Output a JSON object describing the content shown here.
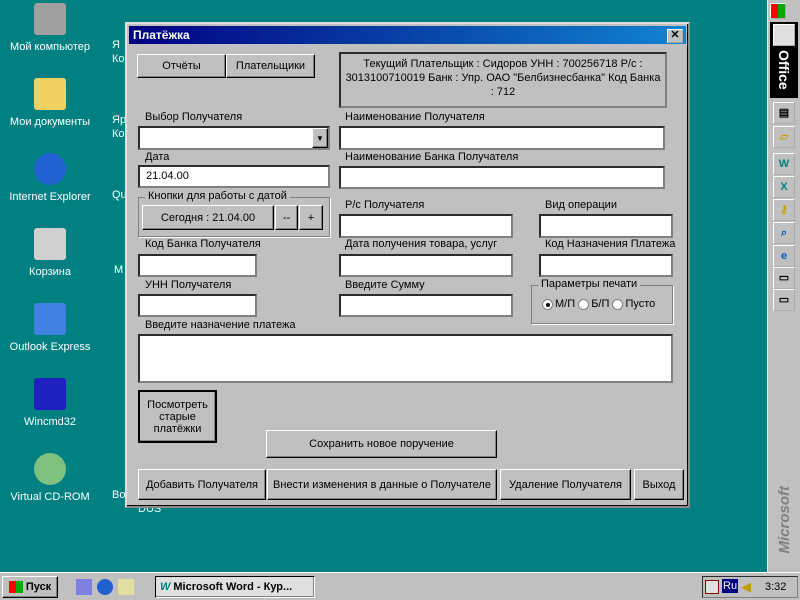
{
  "desktop": {
    "icons": [
      {
        "label": "Мой компьютер",
        "color": "#a0a0a0"
      },
      {
        "label": "Мои документы",
        "color": "#f0d060"
      },
      {
        "label": "Internet Explorer",
        "color": "#2060d0"
      },
      {
        "label": "Корзина",
        "color": "#d0d0d0"
      },
      {
        "label": "Outlook Express",
        "color": "#4080e0"
      },
      {
        "label": "Wincmd32",
        "color": "#2020c0"
      },
      {
        "label": "Virtual CD-ROM",
        "color": "#80c080"
      }
    ],
    "partial_labels": [
      "Я\nКо",
      "Яр\nКо",
      "Qu",
      "М",
      "Во",
      "DUS"
    ]
  },
  "window": {
    "title": "Платёжка",
    "close": "✕",
    "buttons": {
      "reports": "Отчёты",
      "payers": "Плательщики",
      "view_old": "Посмотреть старые платёжки",
      "save_new": "Сохранить новое поручение",
      "add_recipient": "Добавить Получателя",
      "edit_recipient": "Внести изменения в данные о Получателе",
      "delete_recipient": "Удаление Получателя",
      "exit": "Выход"
    },
    "info": "Текущий Плательщик : Сидоров УНН : 700256718 Р/с : 3013100710019 Банк : Упр. ОАО \"Белбизнесбанка\" Код Банка : 712",
    "fields": {
      "recipient_select": {
        "label": "Выбор Получателя",
        "value": ""
      },
      "recipient_name": {
        "label": "Наименование Получателя",
        "value": ""
      },
      "date": {
        "label": "Дата",
        "value": "21.04.00"
      },
      "bank_name": {
        "label": "Наименование Банка Получателя",
        "value": ""
      },
      "account": {
        "label": "Р/с Получателя",
        "value": ""
      },
      "operation": {
        "label": "Вид операции",
        "value": ""
      },
      "bank_code": {
        "label": "Код Банка Получателя",
        "value": ""
      },
      "goods_date": {
        "label": "Дата получения товара, услуг",
        "value": ""
      },
      "purpose_code": {
        "label": "Код Назначения Платежа",
        "value": ""
      },
      "unn": {
        "label": "УНН Получателя",
        "value": ""
      },
      "amount": {
        "label": "Введите Сумму",
        "value": ""
      },
      "purpose": {
        "label": "Введите назначение платежа",
        "value": ""
      }
    },
    "date_group": {
      "label": "Кнопки для работы с датой",
      "today": "Сегодня : 21.04.00",
      "minus": "--",
      "plus": "+"
    },
    "print_group": {
      "label": "Параметры печати",
      "options": [
        "М/П",
        "Б/П",
        "Пусто"
      ],
      "selected": "М/П"
    }
  },
  "taskbar": {
    "start": "Пуск",
    "task": "Microsoft Word - Кур...",
    "lang": "Ru",
    "clock": "3:32"
  },
  "office_bar": {
    "label": "Office",
    "brand": "Microsoft"
  }
}
